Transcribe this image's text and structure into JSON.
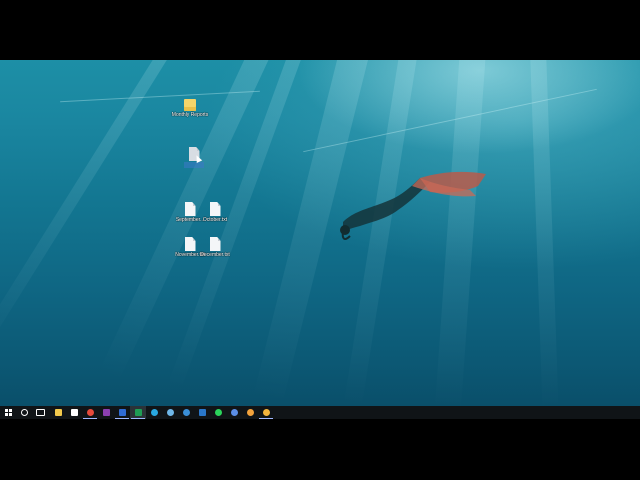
{
  "desktop": {
    "icons": [
      {
        "label": "Monthly Reports",
        "type": "folder",
        "selected": false
      },
      {
        "label": "",
        "type": "doc",
        "selected": true
      },
      {
        "label": "September...",
        "type": "doc",
        "selected": false
      },
      {
        "label": "October.txt",
        "type": "doc",
        "selected": false
      },
      {
        "label": "November.txt",
        "type": "doc",
        "selected": false
      },
      {
        "label": "December.txt",
        "type": "doc",
        "selected": false
      }
    ]
  },
  "taskbar": {
    "buttons": [
      {
        "name": "start-button",
        "icon": "windows-logo-icon",
        "color": "#ffffff"
      },
      {
        "name": "search-button",
        "icon": "search-icon",
        "color": "#ffffff"
      },
      {
        "name": "task-view-button",
        "icon": "task-view-icon",
        "color": "#ffffff"
      },
      {
        "name": "file-explorer-button",
        "icon": "folder-icon",
        "color": "#f2c94c"
      },
      {
        "name": "store-button",
        "icon": "shopping-bag-icon",
        "color": "#ffffff"
      },
      {
        "name": "chrome-button",
        "icon": "chrome-icon",
        "color": "#e64a3b"
      },
      {
        "name": "onenote-button",
        "icon": "onenote-icon",
        "color": "#8b3fb0"
      },
      {
        "name": "word-button",
        "icon": "word-icon",
        "color": "#2f6bd3"
      },
      {
        "name": "excel-button",
        "icon": "excel-icon",
        "color": "#1f9d55"
      },
      {
        "name": "skype-button",
        "icon": "skype-icon",
        "color": "#29a8e0"
      },
      {
        "name": "paint-button",
        "icon": "paint-icon",
        "color": "#6fb7e8"
      },
      {
        "name": "internet-explorer-button",
        "icon": "ie-icon",
        "color": "#3a8fd8"
      },
      {
        "name": "outlook-button",
        "icon": "outlook-icon",
        "color": "#2a77c9"
      },
      {
        "name": "spotify-button",
        "icon": "spotify-icon",
        "color": "#2bd45b"
      },
      {
        "name": "settings-button",
        "icon": "gear-icon",
        "color": "#5b8ee6"
      },
      {
        "name": "app-button-1",
        "icon": "sun-icon",
        "color": "#f3a33c"
      },
      {
        "name": "app-button-2",
        "icon": "sun-icon",
        "color": "#f3b43c"
      }
    ]
  }
}
